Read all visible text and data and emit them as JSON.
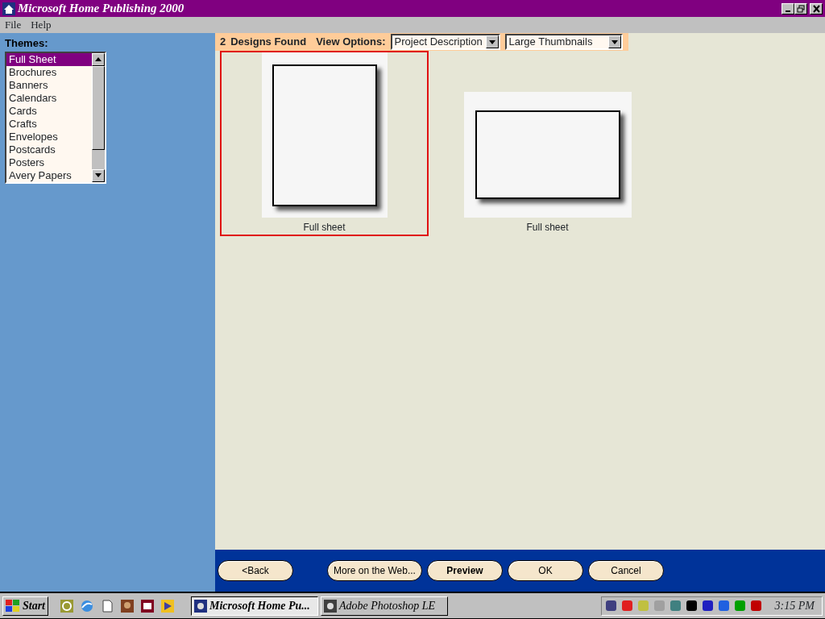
{
  "window": {
    "title": "Microsoft Home Publishing 2000"
  },
  "menu": [
    "File",
    "Help"
  ],
  "themes": {
    "label": "Themes:",
    "items": [
      {
        "label": "Full Sheet",
        "selected": true
      },
      {
        "label": "Brochures",
        "selected": false
      },
      {
        "label": "Banners",
        "selected": false
      },
      {
        "label": "Calendars",
        "selected": false
      },
      {
        "label": "Cards",
        "selected": false
      },
      {
        "label": "Crafts",
        "selected": false
      },
      {
        "label": "Envelopes",
        "selected": false
      },
      {
        "label": "Postcards",
        "selected": false
      },
      {
        "label": "Posters",
        "selected": false
      },
      {
        "label": "Avery Papers",
        "selected": false
      }
    ]
  },
  "header": {
    "count": "2",
    "found_label": "Designs Found",
    "view_label": "View Options:",
    "view_select": "Project Description",
    "size_select": "Large Thumbnails"
  },
  "designs": [
    {
      "label": "Full sheet",
      "kind": "portrait",
      "selected": true
    },
    {
      "label": "Full sheet",
      "kind": "landscape",
      "selected": false
    }
  ],
  "buttons": [
    {
      "label": "<Back",
      "kind": "normal"
    },
    {
      "label": "More on the Web...",
      "kind": "normal"
    },
    {
      "label": "Preview",
      "kind": "bold"
    },
    {
      "label": "OK",
      "kind": "normal"
    },
    {
      "label": "Cancel",
      "kind": "normal"
    }
  ],
  "taskbar": {
    "start": "Start",
    "tasks": [
      {
        "label": "Microsoft Home Pu...",
        "selected": true
      },
      {
        "label": "Adobe Photoshop LE",
        "selected": false
      }
    ],
    "clock": "3:15 PM"
  }
}
